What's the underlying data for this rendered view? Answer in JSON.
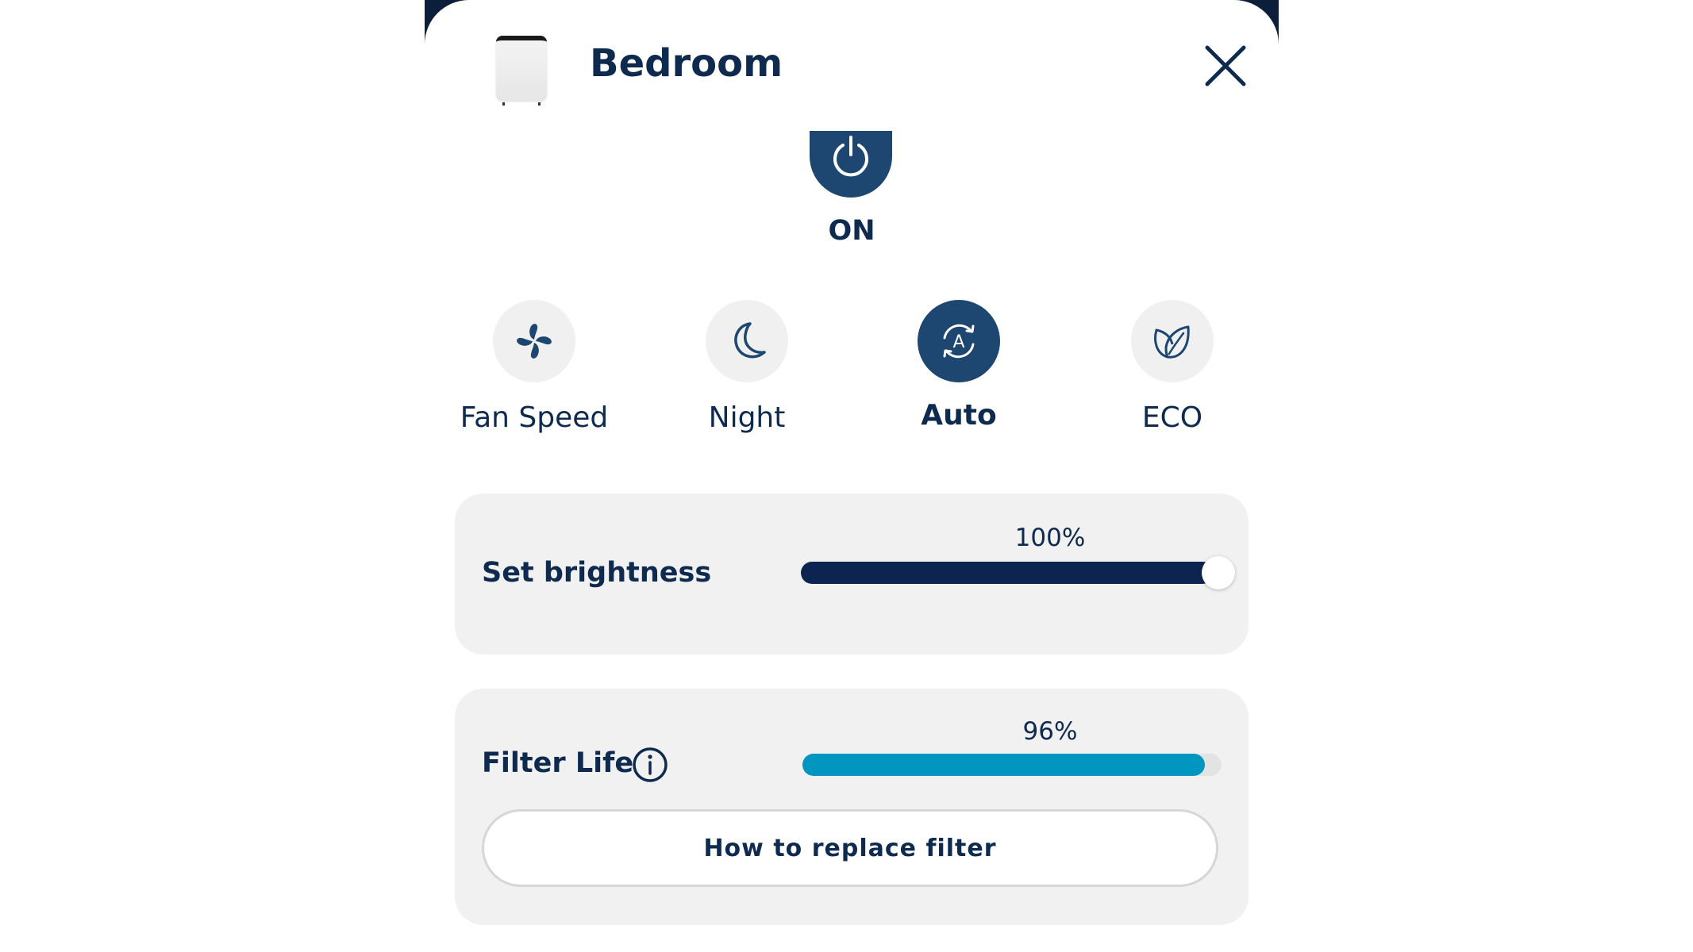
{
  "header": {
    "device_icon": "air-purifier-icon",
    "title": "Bedroom",
    "close_icon": "close-icon"
  },
  "power": {
    "icon": "power-icon",
    "state_label": "ON"
  },
  "modes": [
    {
      "label": "Fan Speed",
      "icon": "fan-icon",
      "active": false
    },
    {
      "label": "Night",
      "icon": "moon-icon",
      "active": false
    },
    {
      "label": "Auto",
      "icon": "auto-mode-icon",
      "active": true
    },
    {
      "label": "ECO",
      "icon": "leaf-icon",
      "active": false
    }
  ],
  "brightness": {
    "title": "Set brightness",
    "value_label": "100%",
    "value": 100
  },
  "filter": {
    "title": "Filter Life",
    "info_icon": "info-icon",
    "value_label": "96%",
    "value": 96,
    "replace_button_label": "How to replace filter"
  },
  "colors": {
    "navy": "#0f2a4f",
    "accent_dark": "#1d4670",
    "brightness_fill": "#0b2450",
    "filter_fill": "#0096bf",
    "card_bg": "#f1f1f1"
  }
}
